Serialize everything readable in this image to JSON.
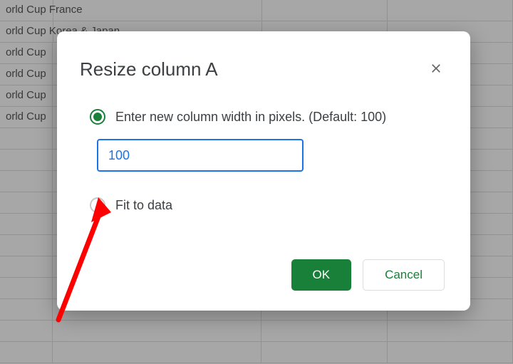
{
  "sheet": {
    "rows": [
      "orld Cup France",
      "orld Cup Korea & Japan",
      "orld Cup",
      "orld Cup",
      "orld Cup",
      "orld Cup"
    ]
  },
  "dialog": {
    "title": "Resize column A",
    "option_enter_width": "Enter new column width in pixels. (Default: 100)",
    "option_fit": "Fit to data",
    "input_value": "100",
    "ok_label": "OK",
    "cancel_label": "Cancel"
  }
}
